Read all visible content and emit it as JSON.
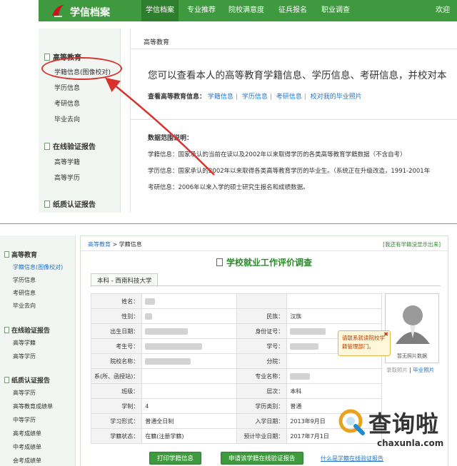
{
  "top": {
    "logo": "学信档案",
    "nav": [
      "学信档案",
      "专业推荐",
      "院校满意度",
      "征兵报名",
      "职业调查",
      "欢迎"
    ],
    "sidebar": {
      "cat1": "高等教育",
      "cat1_items": [
        "学籍信息(图像校对)",
        "学历信息",
        "考研信息",
        "毕业去向"
      ],
      "cat2": "在线验证报告",
      "cat2_items": [
        "高等学籍",
        "高等学历"
      ],
      "cat3": "纸质认证报告"
    },
    "breadcrumb": "高等教育",
    "heading": "您可以查看本人的高等教育学籍信息、学历信息、考研信息，并校对本",
    "links_label": "查看高等教育信息：",
    "links": [
      "学籍信息",
      "学历信息",
      "考研信息",
      "校对我的毕业照片"
    ],
    "range_title": "数据范围说明：",
    "range_lines": [
      "学籍信息：国家承认的当前在读以及2002年以来取得学历的各类高等教育学籍数据（不含自考）",
      "学历信息：国家承认的2002年以来取得各类高等教育学历的毕业生。（系统正在升级改造，1991-2001年",
      "考研信息：2006年以来入学的硕士研究生报名和成绩数据。"
    ]
  },
  "bottom": {
    "sidebar": {
      "cat1": "高等教育",
      "cat1_items": [
        "学籍信息(图像校对)",
        "学历信息",
        "考研信息",
        "毕业去向"
      ],
      "cat2": "在线验证报告",
      "cat2_items": [
        "高等学籍",
        "高等学历"
      ],
      "cat3": "纸质认证报告",
      "cat3_items": [
        "高等学历",
        "高等教育成绩单",
        "中等学历",
        "高考成绩单",
        "中考成绩单",
        "会考成绩单"
      ]
    },
    "breadcrumb_a": "高等教育",
    "breadcrumb_sep": " > ",
    "breadcrumb_b": "学籍信息",
    "report_link": "[我还有学籍没显示出来]",
    "survey_title": "学校就业工作评价调查",
    "school_tab": "本科 - 西南科技大学",
    "rows": [
      {
        "k1": "姓名：",
        "v1": "",
        "k2": "",
        "v2": ""
      },
      {
        "k1": "性别：",
        "v1": "",
        "k2": "民族：",
        "v2": "汉族"
      },
      {
        "k1": "出生日期：",
        "v1": "",
        "k2": "身份证号：",
        "v2": ""
      },
      {
        "k1": "考生号：",
        "v1": "",
        "k2": "学号：",
        "v2": ""
      },
      {
        "k1": "院校名称：",
        "v1": "",
        "k2": "分院：",
        "v2": ""
      },
      {
        "k1": "系(所、函授站)：",
        "v1": "",
        "k2": "专业名称：",
        "v2": ""
      },
      {
        "k1": "班级：",
        "v1": "",
        "k2": "层次：",
        "v2": "本科"
      },
      {
        "k1": "学制：",
        "v1": "4",
        "k2": "学历类别：",
        "v2": "普通"
      },
      {
        "k1": "学习形式：",
        "v1": "普通全日制",
        "k2": "入学日期：",
        "v2": "2013年9月日"
      },
      {
        "k1": "学籍状态：",
        "v1": "在籍(注册学籍)",
        "k2": "预计毕业日期：",
        "v2": "2017年7月1日"
      }
    ],
    "photo_caption": "暂无照片数据",
    "photo_link1": "录取照片",
    "photo_link2": "毕业照片",
    "tooltip": "请联系就读院校学籍管理部门。",
    "btn_print": "打印学籍信息",
    "btn_apply": "申请该学籍在线验证报告",
    "help_link": "什么是学籍在线验证报告"
  },
  "watermark": {
    "text": "查询啦",
    "url": "chaxunla.com"
  },
  "colors": {
    "green": "#3f9a3f",
    "link": "#1f74c8",
    "annotation": "#d9322c"
  }
}
